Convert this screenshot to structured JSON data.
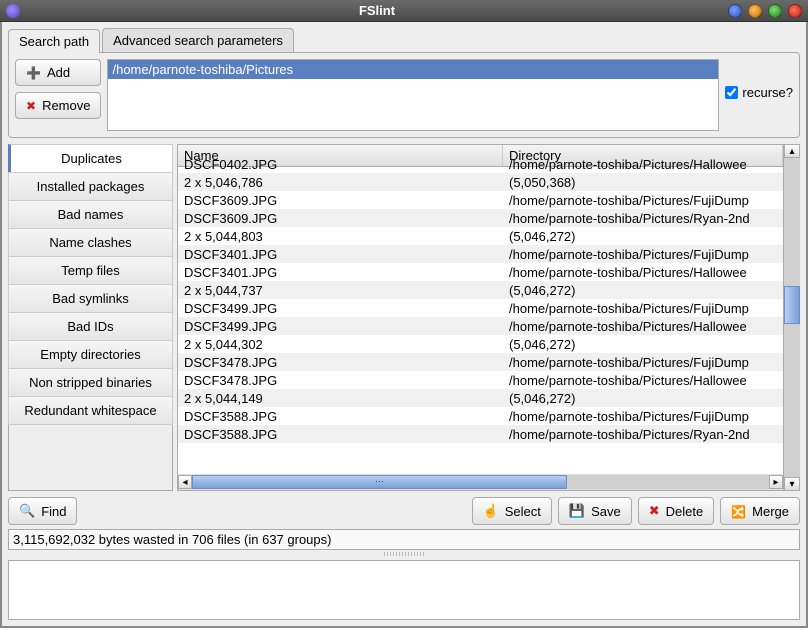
{
  "window": {
    "title": "FSlint"
  },
  "tabs": {
    "search_path": "Search path",
    "advanced": "Advanced search parameters"
  },
  "buttons": {
    "add": "Add",
    "remove": "Remove",
    "find": "Find",
    "select": "Select",
    "save": "Save",
    "delete": "Delete",
    "merge": "Merge"
  },
  "paths": {
    "selected": "/home/parnote-toshiba/Pictures"
  },
  "recurse": {
    "label": "recurse?",
    "checked": true
  },
  "sidebar": {
    "items": [
      "Duplicates",
      "Installed packages",
      "Bad names",
      "Name clashes",
      "Temp files",
      "Bad symlinks",
      "Bad IDs",
      "Empty directories",
      "Non stripped binaries",
      "Redundant whitespace"
    ],
    "active": 0
  },
  "table": {
    "headers": {
      "name": "Name",
      "dir": "Directory"
    },
    "rows": [
      {
        "name": "DSCF0402.JPG",
        "dir": "/home/parnote-toshiba/Pictures/Hallowee"
      },
      {
        "name": "2 x 5,046,786",
        "dir": "(5,050,368)"
      },
      {
        "name": "DSCF3609.JPG",
        "dir": "/home/parnote-toshiba/Pictures/FujiDump"
      },
      {
        "name": "DSCF3609.JPG",
        "dir": "/home/parnote-toshiba/Pictures/Ryan-2nd"
      },
      {
        "name": "2 x 5,044,803",
        "dir": "(5,046,272)"
      },
      {
        "name": "DSCF3401.JPG",
        "dir": "/home/parnote-toshiba/Pictures/FujiDump"
      },
      {
        "name": "DSCF3401.JPG",
        "dir": "/home/parnote-toshiba/Pictures/Hallowee"
      },
      {
        "name": "2 x 5,044,737",
        "dir": "(5,046,272)"
      },
      {
        "name": "DSCF3499.JPG",
        "dir": "/home/parnote-toshiba/Pictures/FujiDump"
      },
      {
        "name": "DSCF3499.JPG",
        "dir": "/home/parnote-toshiba/Pictures/Hallowee"
      },
      {
        "name": "2 x 5,044,302",
        "dir": "(5,046,272)"
      },
      {
        "name": "DSCF3478.JPG",
        "dir": "/home/parnote-toshiba/Pictures/FujiDump"
      },
      {
        "name": "DSCF3478.JPG",
        "dir": "/home/parnote-toshiba/Pictures/Hallowee"
      },
      {
        "name": "2 x 5,044,149",
        "dir": "(5,046,272)"
      },
      {
        "name": "DSCF3588.JPG",
        "dir": "/home/parnote-toshiba/Pictures/FujiDump"
      },
      {
        "name": "DSCF3588.JPG",
        "dir": "/home/parnote-toshiba/Pictures/Ryan-2nd"
      }
    ]
  },
  "status": "3,115,692,032 bytes wasted in 706 files (in 637 groups)"
}
